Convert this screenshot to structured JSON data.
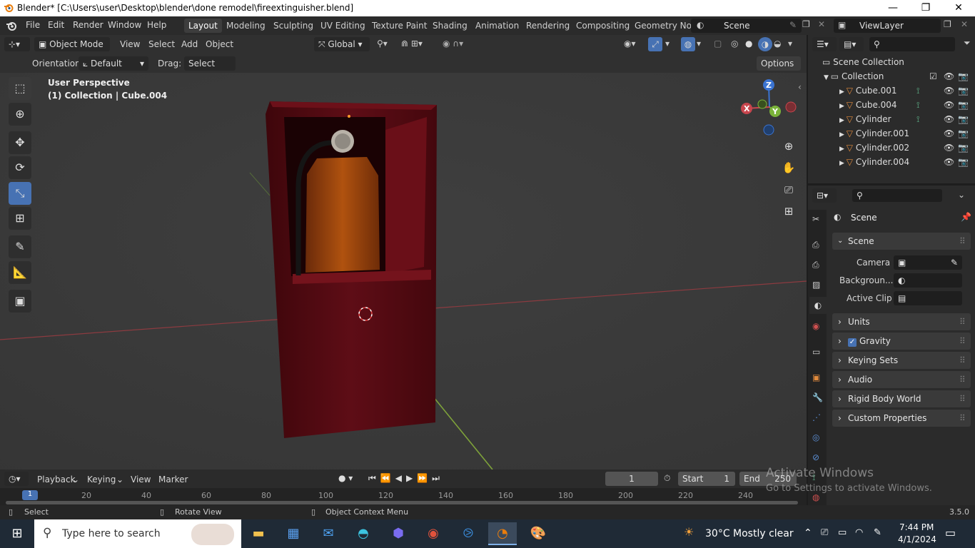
{
  "titlebar": {
    "title": "Blender* [C:\\Users\\user\\Desktop\\blender\\done remodel\\fireextinguisher.blend]",
    "minimize": "—",
    "maximize": "❐",
    "close": "✕"
  },
  "menus": [
    "File",
    "Edit",
    "Render",
    "Window",
    "Help"
  ],
  "workspaces": [
    "Layout",
    "Modeling",
    "Sculpting",
    "UV Editing",
    "Texture Paint",
    "Shading",
    "Animation",
    "Rendering",
    "Compositing",
    "Geometry Noc"
  ],
  "scene_field": "Scene",
  "viewlayer_field": "ViewLayer",
  "viewport_header": {
    "mode": "Object Mode",
    "menus": [
      "View",
      "Select",
      "Add",
      "Object"
    ],
    "transform_orientation": "Global"
  },
  "tool_settings": {
    "orientation_label": "Orientation:",
    "orientation_value": "Default",
    "drag_label": "Drag:",
    "drag_value": "Select Box",
    "options": "Options"
  },
  "viewport": {
    "perspective": "User Perspective",
    "collection_info": "(1) Collection | Cube.004",
    "gizmo_x": "X",
    "gizmo_y": "Y",
    "gizmo_z": "Z"
  },
  "outliner": {
    "root": "Scene Collection",
    "collection": "Collection",
    "items": [
      "Cube.001",
      "Cube.004",
      "Cylinder",
      "Cylinder.001",
      "Cylinder.002",
      "Cylinder.004"
    ]
  },
  "properties": {
    "context": "Scene",
    "panel": "Scene",
    "camera_label": "Camera",
    "background_label": "Backgroun...",
    "active_clip_label": "Active Clip",
    "subpanels": [
      "Units",
      "Gravity",
      "Keying Sets",
      "Audio",
      "Rigid Body World",
      "Custom Properties"
    ],
    "gravity_checked": true
  },
  "timeline": {
    "menus": [
      "Playback",
      "Keying",
      "View",
      "Marker"
    ],
    "current_frame": "1",
    "start_label": "Start",
    "start_value": "1",
    "end_label": "End",
    "end_value": "250",
    "ruler": [
      "1",
      "20",
      "40",
      "60",
      "80",
      "100",
      "120",
      "140",
      "160",
      "180",
      "200",
      "220",
      "240"
    ]
  },
  "statusbar": {
    "select": "Select",
    "rotate": "Rotate View",
    "context_menu": "Object Context Menu",
    "version": "3.5.0"
  },
  "activation": {
    "line1": "Activate Windows",
    "line2": "Go to Settings to activate Windows."
  },
  "taskbar": {
    "search_placeholder": "Type here to search",
    "weather": "30°C  Mostly clear",
    "time": "7:44 PM",
    "date": "4/1/2024"
  },
  "colors": {
    "accent": "#4772b3",
    "cabinet": "#5a0c14",
    "x_axis": "#c8464e",
    "y_axis": "#7bb33a",
    "z_axis": "#3a73d1"
  }
}
